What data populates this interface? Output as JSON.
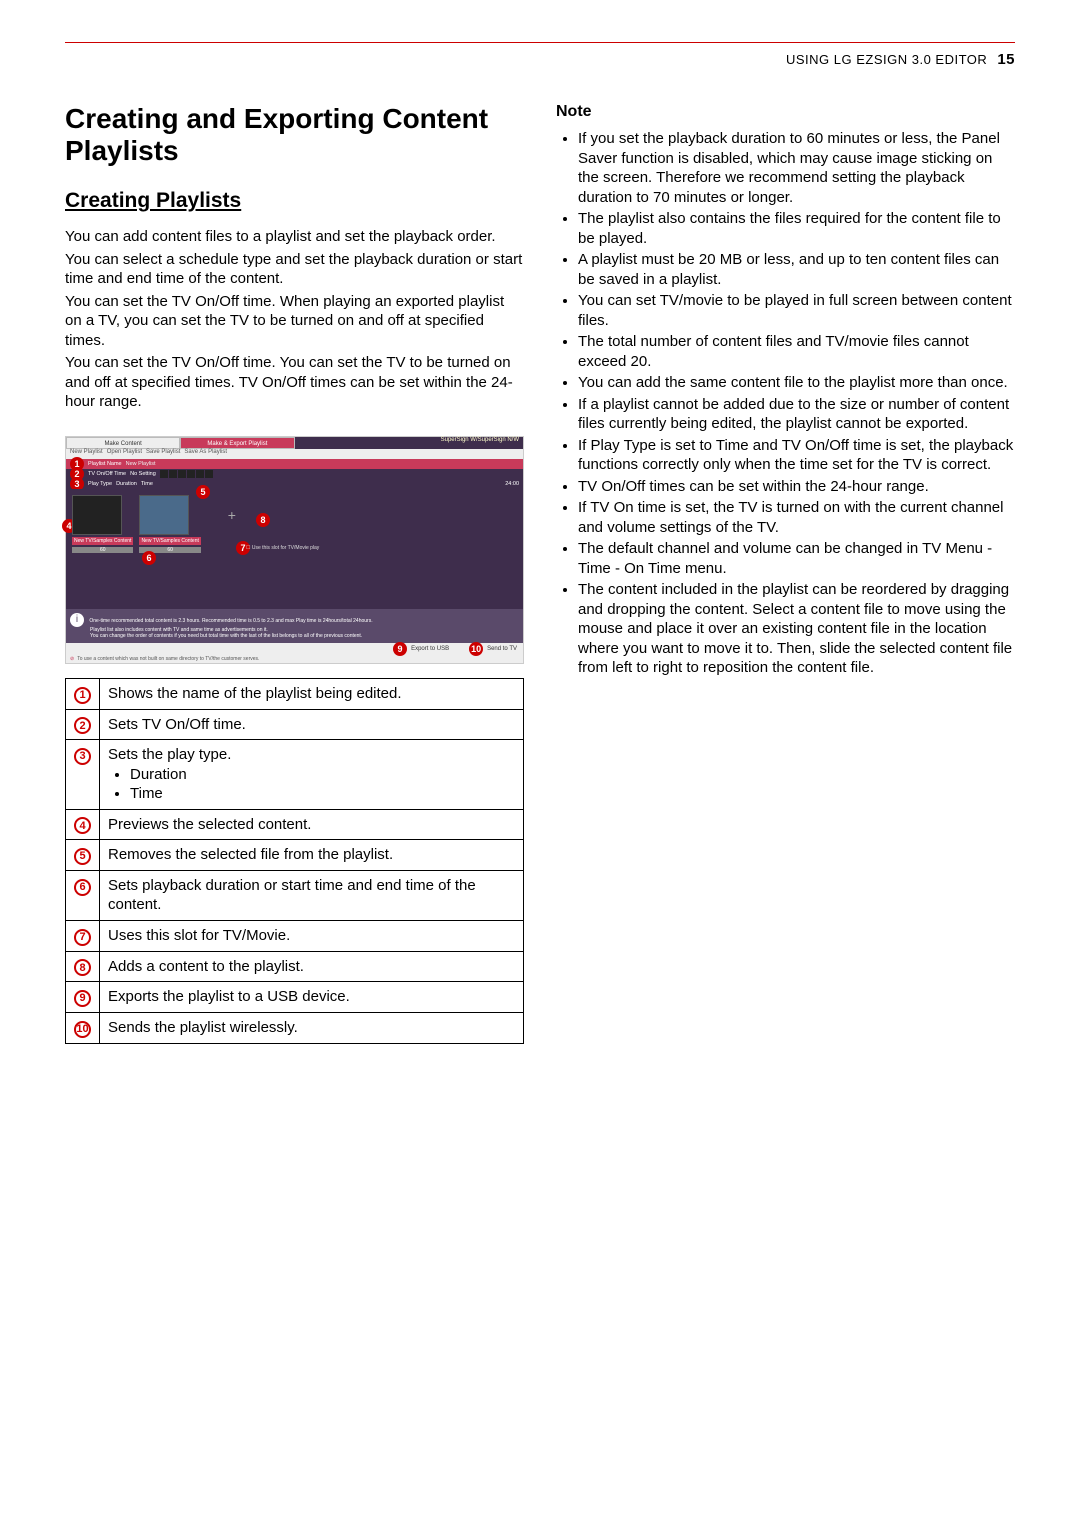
{
  "header": {
    "title": "USING LG EZSIGN 3.0 EDITOR",
    "page": "15"
  },
  "h1": "Creating and Exporting Content Playlists",
  "h2": "Creating Playlists",
  "intro": {
    "p1": "You can add content files to a playlist and set the playback order.",
    "p2": "You can select a schedule type and set the playback duration or start time and end time of the content.",
    "p3": "You can set the TV On/Off time. When playing an exported playlist on a TV, you can set the TV to be turned on and off at specified times.",
    "p4": "You can set the TV On/Off time. You can set the TV to be turned on and off at specified times. TV On/Off times can be set within the 24-hour range."
  },
  "screenshot": {
    "tab1": "Make Content",
    "tab2": "Make & Export Playlist",
    "right_link": "SuperSign W/SuperSign N/W",
    "tb_new": "New Playlist",
    "tb_open": "Open Playlist",
    "tb_save": "Save Playlist",
    "tb_saveas": "Save As Playlist",
    "row_playlist": "Playlist Name",
    "row_playlist_val": "New Playlist",
    "row_tv": "TV On/Off Time",
    "row_tv_opt": "No Setting",
    "row_play": "Play Type",
    "row_play_opt1": "Duration",
    "row_play_opt2": "Time",
    "row_play_val": "24:00",
    "btn_new_tv1": "New TV/Samples Content",
    "btn_new_tv2": "New TV/Samples Content",
    "cb_label": "Use this slot for TV/Movie play",
    "info1": "One-time recommended total content is 2.3 hours. Recommended time is 0.5 to 2.3 and max Play time is 24hours/total 24hours.",
    "info2": "Playlist list also includes content with TV and same time as advertisements on it.",
    "info3": "You can change the order of contents if you need but total time with the last of the list belongs to all of the previous content.",
    "btn_export": "Export to USB",
    "btn_send": "Send to TV",
    "footer": "To use a content which was not built on same directory to TV/the customer serves."
  },
  "legend": [
    {
      "n": "❶",
      "t": "Shows the name of the playlist being edited."
    },
    {
      "n": "❷",
      "t": "Sets TV On/Off time."
    },
    {
      "n": "❸",
      "t": "Sets the play type.",
      "sub": [
        "Duration",
        "Time"
      ]
    },
    {
      "n": "❹",
      "t": "Previews the selected content."
    },
    {
      "n": "❺",
      "t": "Removes the selected file from the playlist."
    },
    {
      "n": "❻",
      "t": "Sets playback duration or start time and end time of the content."
    },
    {
      "n": "❼",
      "t": "Uses this slot for TV/Movie."
    },
    {
      "n": "❽",
      "t": "Adds a content to the playlist."
    },
    {
      "n": "❾",
      "t": "Exports the playlist to a USB device."
    },
    {
      "n": "❿",
      "t": "Sends the playlist wirelessly."
    }
  ],
  "note_title": "Note",
  "notes": [
    "If you set the playback duration to 60 minutes or less, the Panel Saver function is disabled, which may cause image sticking on the screen. Therefore we recommend setting the playback duration to 70 minutes or longer.",
    "The playlist also contains the files required for the content file to be played.",
    "A playlist must be 20 MB or less, and up to ten content files can be saved in a playlist.",
    "You can set TV/movie to be played in full screen between content files.",
    "The total number of content files and TV/movie files cannot exceed 20.",
    "You can add the same content file to the playlist more than once.",
    "If a playlist cannot be added due to the size or number of content files currently being edited, the playlist cannot be exported.",
    "If Play Type is set to Time and TV On/Off time is set, the playback functions correctly only when the time set for the TV is correct.",
    "TV On/Off times can be set within the 24-hour range.",
    "If TV On time is set, the TV is turned on with the current channel and volume settings of the TV.",
    "The default channel and volume can be changed in TV Menu - Time - On Time menu.",
    "The content included in the playlist can be reordered by dragging and dropping the content. Select a content file to move using the mouse and place it over an existing content file in the location where you want to move it to. Then, slide the selected content file from left to right to reposition the content file."
  ]
}
